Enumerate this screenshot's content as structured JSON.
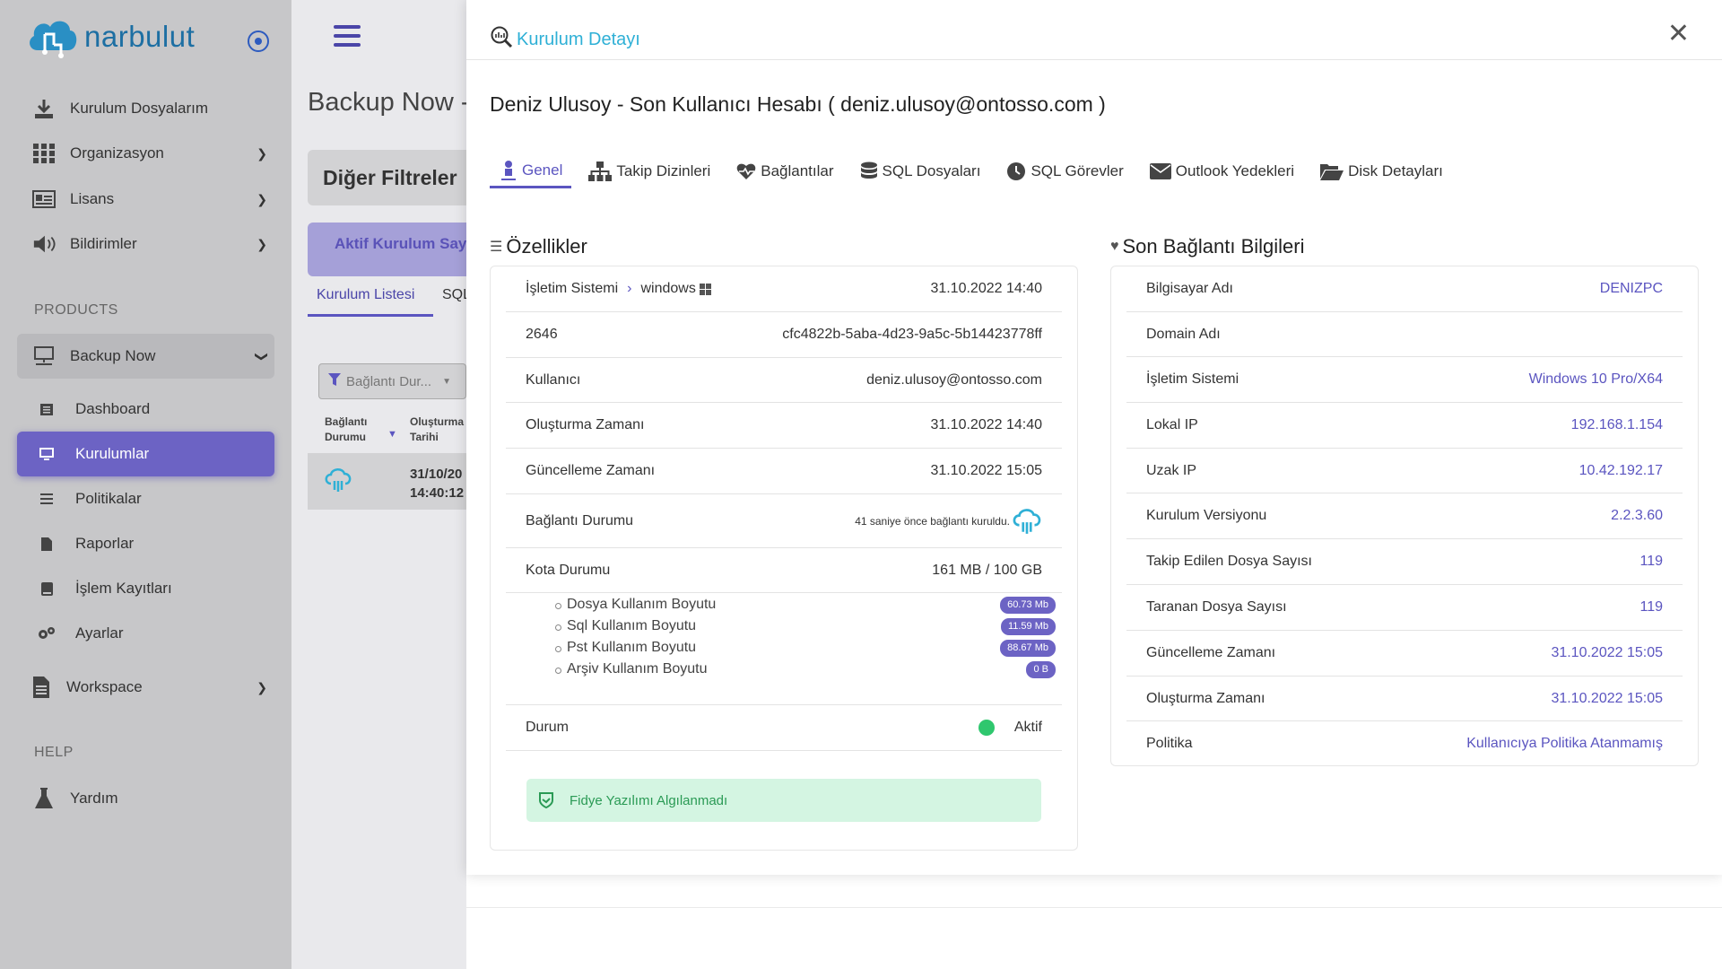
{
  "brand": {
    "name": "narbulut"
  },
  "sidebar": {
    "items": [
      {
        "label": "Kurulum Dosyalarım",
        "icon": "download-icon"
      },
      {
        "label": "Organizasyon",
        "icon": "grid-icon"
      },
      {
        "label": "Lisans",
        "icon": "id-card-icon"
      },
      {
        "label": "Bildirimler",
        "icon": "speaker-icon"
      }
    ],
    "products_label": "PRODUCTS",
    "backup_now_label": "Backup Now",
    "sub_items": [
      {
        "label": "Dashboard"
      },
      {
        "label": "Kurulumlar"
      },
      {
        "label": "Politikalar"
      },
      {
        "label": "Raporlar"
      },
      {
        "label": "İşlem Kayıtları"
      },
      {
        "label": "Ayarlar"
      }
    ],
    "workspace_label": "Workspace",
    "help_label": "HELP",
    "help_item": "Yardım"
  },
  "background": {
    "title": "Backup Now -",
    "filter_card": "Diğer Filtreler",
    "aktif_card": "Aktif Kurulum Sayı",
    "tab_active": "Kurulum Listesi",
    "tab_next": "SQL",
    "select_placeholder": "Bağlantı Dur...",
    "th_1_a": "Bağlantı",
    "th_1_b": "Durumu",
    "th_2_a": "Oluşturma",
    "th_2_b": "Tarihi",
    "row_date": "31/10/20",
    "row_time": "14:40:12"
  },
  "modal": {
    "title": "Kurulum Detayı",
    "close": "✕",
    "account_title": "Deniz Ulusoy - Son Kullanıcı Hesabı ( deniz.ulusoy@ontosso.com )",
    "tabs": [
      {
        "label": "Genel"
      },
      {
        "label": "Takip Dizinleri"
      },
      {
        "label": "Bağlantılar"
      },
      {
        "label": "SQL Dosyaları"
      },
      {
        "label": "SQL Görevler"
      },
      {
        "label": "Outlook Yedekleri"
      },
      {
        "label": "Disk Detayları"
      }
    ],
    "props": {
      "title": "Özellikler",
      "os_label": "İşletim Sistemi",
      "os_value": "windows",
      "os_date": "31.10.2022 14:40",
      "id_label": "2646",
      "id_value": "cfc4822b-5aba-4d23-9a5c-5b14423778ff",
      "user_label": "Kullanıcı",
      "user_value": "deniz.ulusoy@ontosso.com",
      "created_label": "Oluşturma Zamanı",
      "created_value": "31.10.2022 14:40",
      "updated_label": "Güncelleme Zamanı",
      "updated_value": "31.10.2022 15:05",
      "conn_label": "Bağlantı Durumu",
      "conn_value": "41 saniye önce bağlantı kuruldu.",
      "quota_label": "Kota Durumu",
      "quota_value": "161 MB / 100 GB",
      "quota_items": [
        {
          "label": "Dosya Kullanım Boyutu",
          "value": "60.73 Mb"
        },
        {
          "label": "Sql Kullanım Boyutu",
          "value": "11.59 Mb"
        },
        {
          "label": "Pst Kullanım Boyutu",
          "value": "88.67 Mb"
        },
        {
          "label": "Arşiv Kullanım Boyutu",
          "value": "0 B"
        }
      ],
      "status_label": "Durum",
      "status_value": "Aktif",
      "alert": "Fidye Yazılımı Algılanmadı"
    },
    "conn": {
      "title": "Son Bağlantı Bilgileri",
      "rows": [
        {
          "label": "Bilgisayar Adı",
          "value": "DENIZPC"
        },
        {
          "label": "Domain Adı",
          "value": ""
        },
        {
          "label": "İşletim Sistemi",
          "value": "Windows 10 Pro/X64"
        },
        {
          "label": "Lokal IP",
          "value": "192.168.1.154"
        },
        {
          "label": "Uzak IP",
          "value": "10.42.192.17"
        },
        {
          "label": "Kurulum Versiyonu",
          "value": "2.2.3.60"
        },
        {
          "label": "Takip Edilen Dosya Sayısı",
          "value": "119"
        },
        {
          "label": "Taranan Dosya Sayısı",
          "value": "119"
        },
        {
          "label": "Güncelleme Zamanı",
          "value": "31.10.2022 15:05"
        },
        {
          "label": "Oluşturma Zamanı",
          "value": "31.10.2022 15:05"
        },
        {
          "label": "Politika",
          "value": "Kullanıcıya Politika Atanmamış"
        }
      ]
    }
  },
  "colors": {
    "accent": "#5b55c0",
    "cyan": "#2fb0d6",
    "success": "#2fc76e"
  }
}
